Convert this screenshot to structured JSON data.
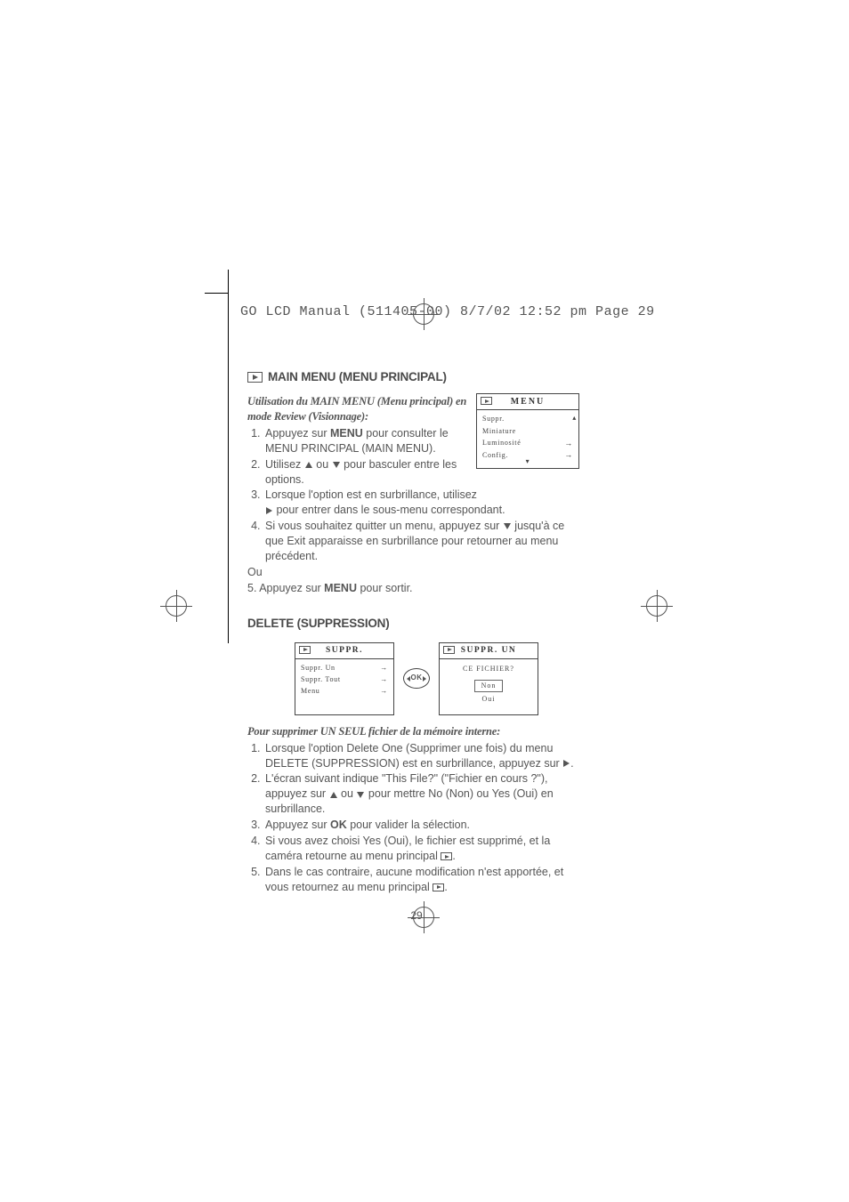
{
  "header_line": "GO LCD Manual (511405-00)  8/7/02  12:52 pm  Page 29",
  "section1": {
    "title": "MAIN MENU (MENU PRINCIPAL)",
    "subhead": "Utilisation du MAIN MENU (Menu principal) en mode Review (Visionnage):",
    "steps": {
      "s1a": "Appuyez sur ",
      "s1_menu": "MENU",
      "s1b": " pour consulter le MENU PRINCIPAL (MAIN MENU).",
      "s2a": "Utilisez ",
      "s2_or": " ou ",
      "s2b": " pour basculer entre les options.",
      "s3a": "Lorsque l'option est en surbrillance, utilisez ",
      "s3b": " pour entrer dans le sous-menu correspondant.",
      "s4a": "Si vous souhaitez quitter un menu, appuyez sur ",
      "s4b": " jusqu'à ce que Exit apparaisse en surbrillance pour retourner au menu précédent."
    },
    "or_label": "Ou",
    "step5a": "5. Appuyez sur ",
    "step5_menu": "MENU",
    "step5b": " pour sortir."
  },
  "menu1": {
    "title": "MENU",
    "items": [
      "Suppr.",
      "Miniature",
      "Luminosité",
      "Config."
    ]
  },
  "section2": {
    "title": "DELETE (SUPPRESSION)",
    "box_suppr": {
      "title": "SUPPR.",
      "items": [
        "Suppr. Un",
        "Suppr. Tout",
        "Menu"
      ]
    },
    "box_suppr_un": {
      "title": "SUPPR. UN",
      "question": "CE FICHIER?",
      "opt_no": "Non",
      "opt_yes": "Oui"
    },
    "ok_label": "OK",
    "subhead": "Pour supprimer UN SEUL fichier de la mémoire interne:",
    "steps": {
      "s1": "Lorsque l'option Delete One (Supprimer une fois) du menu DELETE (SUPPRESSION) est en surbrillance, appuyez sur ",
      "s1b": ".",
      "s2a": "L'écran suivant indique \"This File?\" (\"Fichier en cours ?\"), appuyez sur ",
      "s2_or": " ou ",
      "s2b": " pour mettre No (Non) ou Yes (Oui) en surbrillance.",
      "s3a": "Appuyez sur ",
      "s3_ok": "OK",
      "s3b": " pour valider la sélection.",
      "s4a": "Si vous avez choisi Yes (Oui), le fichier est supprimé, et la caméra retourne au menu principal ",
      "s4b": ".",
      "s5a": "Dans le cas contraire, aucune modification n'est apportée, et vous retournez au menu principal ",
      "s5b": "."
    }
  },
  "page_number": "29"
}
